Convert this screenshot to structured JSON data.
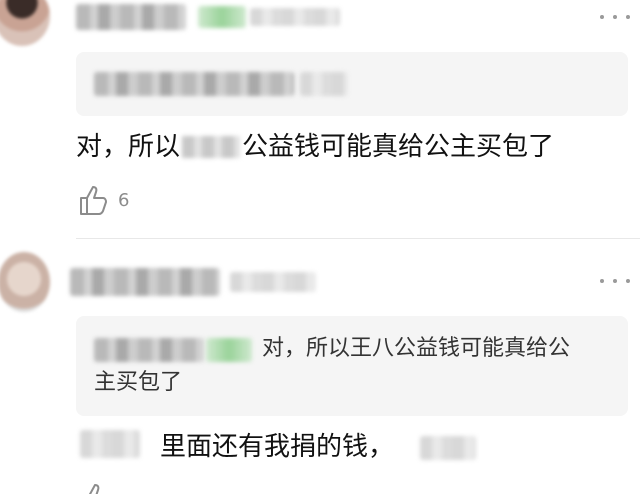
{
  "comments": [
    {
      "text": "对，所以",
      "text_cont": "公益钱可能真给公主买包了",
      "likes": "6"
    },
    {
      "quote_text": "对，所以王八公益钱可能真给公",
      "quote_text_cont": "主买包了",
      "reply_text": "里面还有我捐的钱，"
    }
  ],
  "icons": {
    "more": "more-dots-icon",
    "like": "thumbs-up-icon"
  },
  "colors": {
    "quote_bg": "#f5f5f5",
    "blur_green": "#9ad39a",
    "icon_gray": "#8c8c8c"
  }
}
